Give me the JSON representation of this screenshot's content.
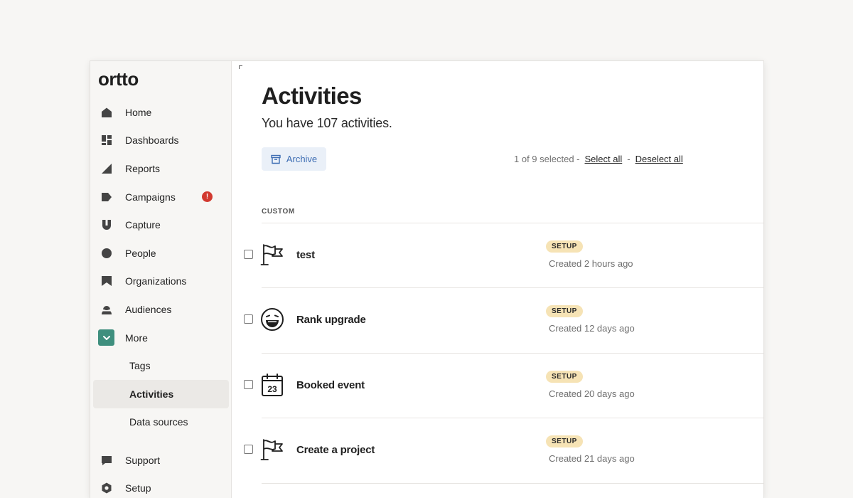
{
  "app": {
    "logo": "ortto"
  },
  "sidebar": {
    "items": [
      {
        "label": "Home",
        "icon": "home-icon"
      },
      {
        "label": "Dashboards",
        "icon": "dashboard-icon"
      },
      {
        "label": "Reports",
        "icon": "reports-icon"
      },
      {
        "label": "Campaigns",
        "icon": "campaigns-icon",
        "badge": "!"
      },
      {
        "label": "Capture",
        "icon": "capture-icon"
      },
      {
        "label": "People",
        "icon": "people-icon"
      },
      {
        "label": "Organizations",
        "icon": "organizations-icon"
      },
      {
        "label": "Audiences",
        "icon": "audiences-icon"
      },
      {
        "label": "More",
        "icon": "chevron-down-icon"
      }
    ],
    "sub_items": [
      {
        "label": "Tags"
      },
      {
        "label": "Activities",
        "active": true
      },
      {
        "label": "Data sources"
      }
    ],
    "bottom_items": [
      {
        "label": "Support",
        "icon": "support-icon"
      },
      {
        "label": "Setup",
        "icon": "setup-icon"
      }
    ]
  },
  "main": {
    "title": "Activities",
    "subtitle": "You have 107 activities.",
    "archive_label": "Archive",
    "selection": {
      "status": "1 of 9 selected -",
      "select_all": "Select all",
      "separator": "-",
      "deselect_all": "Deselect all"
    },
    "section_label": "CUSTOM",
    "activities": [
      {
        "name": "test",
        "icon": "flag-icon",
        "status": "SETUP",
        "created": "Created 2 hours ago"
      },
      {
        "name": "Rank upgrade",
        "icon": "laughing-face-icon",
        "status": "SETUP",
        "created": "Created 12 days ago"
      },
      {
        "name": "Booked event",
        "icon": "calendar-icon",
        "calendar_day": "23",
        "status": "SETUP",
        "created": "Created 20 days ago"
      },
      {
        "name": "Create a project",
        "icon": "flag-icon",
        "status": "SETUP",
        "created": "Created 21 days ago"
      }
    ]
  },
  "colors": {
    "accent_green": "#3f8f7e",
    "alert_red": "#d2392f",
    "link_blue": "#3d6db3",
    "status_bg": "#f6e3b5"
  }
}
